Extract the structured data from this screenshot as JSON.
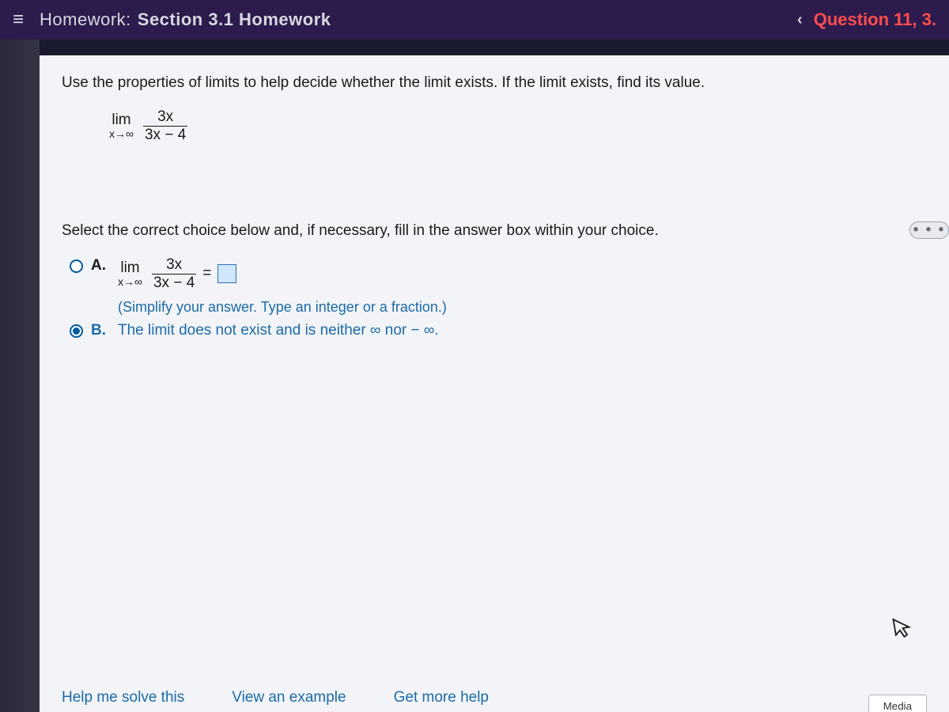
{
  "header": {
    "menu_glyph": "≡",
    "hw_label": "Homework:",
    "hw_title": "Section 3.1 Homework",
    "chev_left": "‹",
    "question_label": "Question 11, 3."
  },
  "problem": {
    "instruction": "Use the properties of limits to help decide whether the limit exists. If the limit exists, find its value.",
    "limit": {
      "lim_word": "lim",
      "lim_sub": "x→∞",
      "numerator": "3x",
      "denominator": "3x − 4"
    },
    "more_glyph": "• • •",
    "select_instruction": "Select the correct choice below and, if necessary, fill in the answer box within your choice."
  },
  "choices": {
    "a": {
      "label": "A.",
      "lim_word": "lim",
      "lim_sub": "x→∞",
      "numerator": "3x",
      "denominator": "3x − 4",
      "equals": "=",
      "hint": "(Simplify your answer. Type an integer or a fraction.)"
    },
    "b": {
      "label": "B.",
      "text": "The limit does not exist and is neither ∞ nor − ∞."
    },
    "selected": "b"
  },
  "footer": {
    "help": "Help me solve this",
    "view": "View an example",
    "more_help": "Get more help",
    "media": "Media"
  },
  "cursor_glyph": "↖"
}
